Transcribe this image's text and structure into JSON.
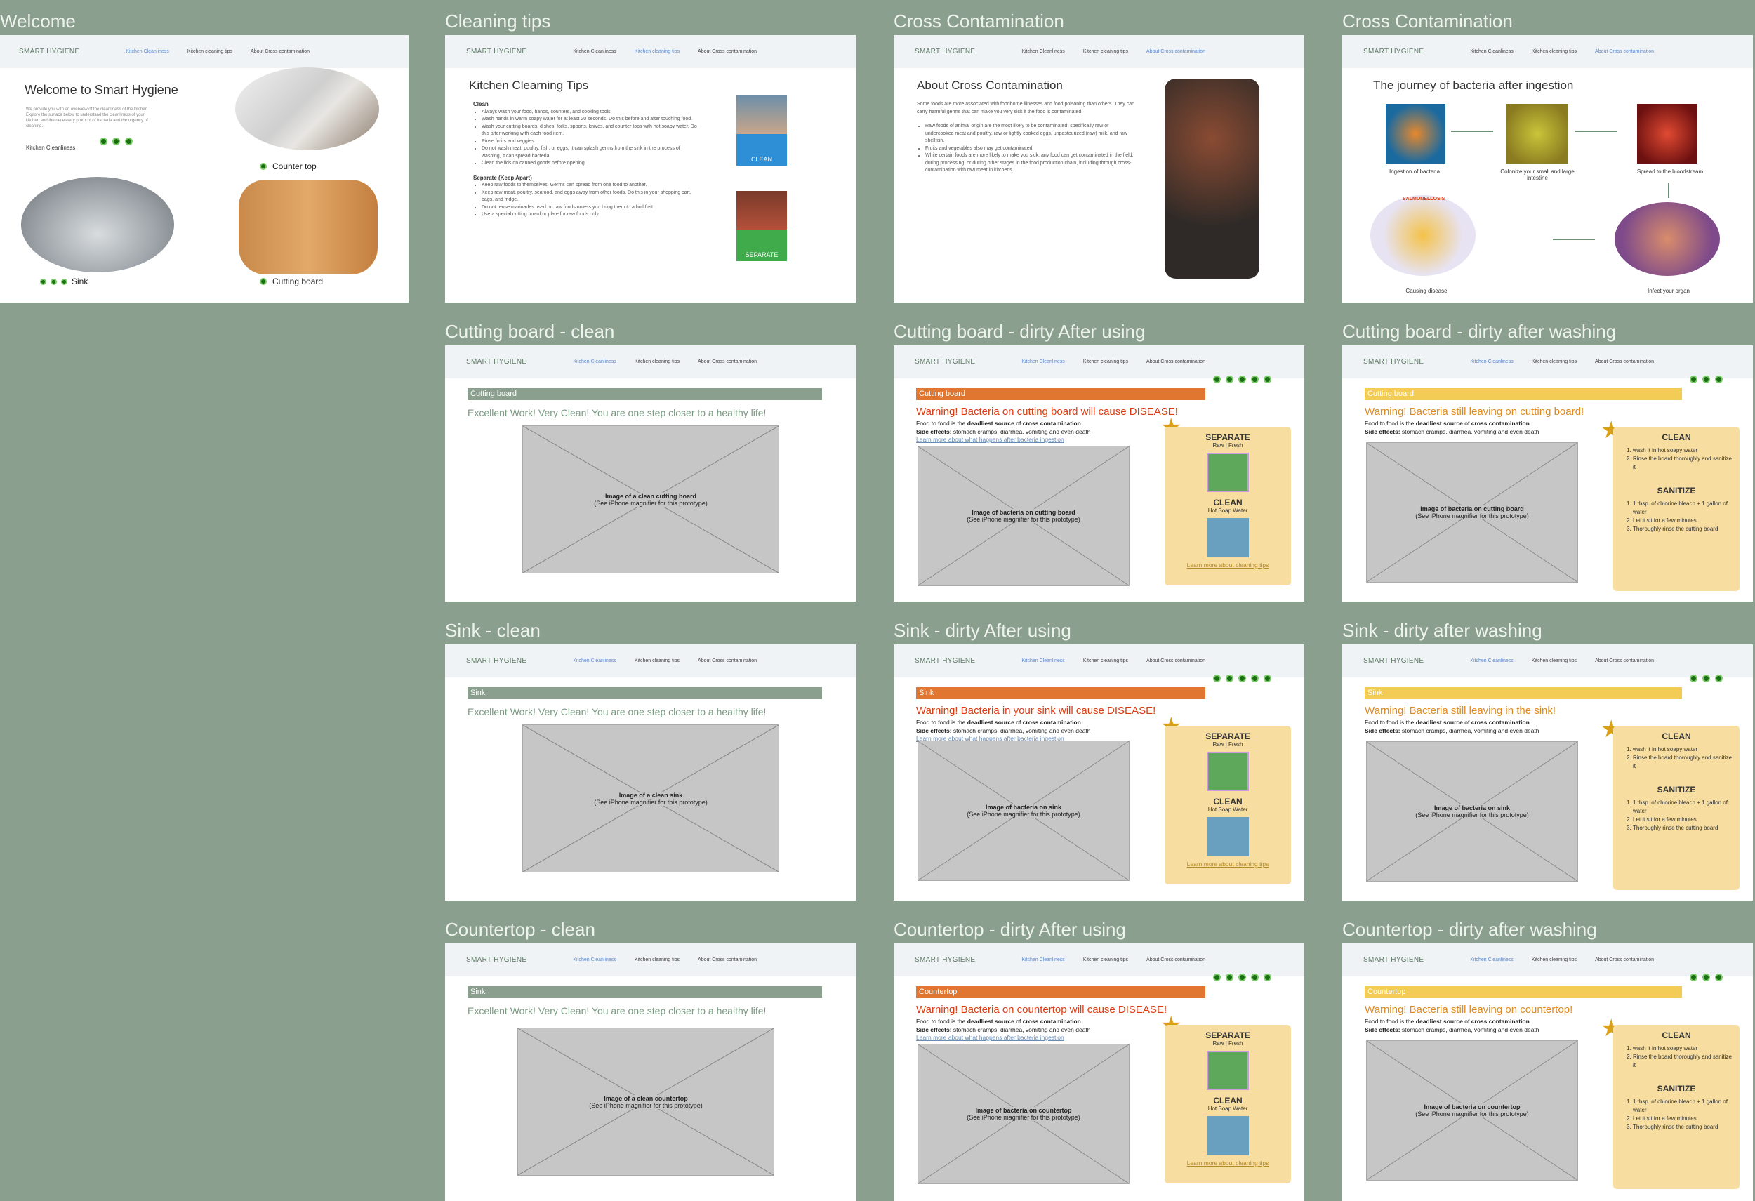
{
  "nav": {
    "logo": "SMART HYGIENE",
    "links": [
      "Kitchen Cleanliness",
      "Kitchen cleaning tips",
      "About Cross contamination"
    ]
  },
  "labels": {
    "welcome": "Welcome",
    "tips": "Cleaning tips",
    "cross1": "Cross Contamination",
    "cross2": "Cross Contamination",
    "cb_clean": "Cutting board - clean",
    "cb_dirty": "Cutting board - dirty After using",
    "cb_wash": "Cutting board - dirty after washing",
    "sink_clean": "Sink - clean",
    "sink_dirty": "Sink - dirty After using",
    "sink_wash": "Sink - dirty after washing",
    "ct_clean": "Countertop - clean",
    "ct_dirty": "Countertop - dirty After using",
    "ct_wash": "Countertop - dirty after washing"
  },
  "welcome": {
    "title": "Welcome to Smart Hygiene",
    "intro": "We provide you with an overview of the cleanliness of the kitchen. Explore the surface below to understand the cleanliness of your kitchen and the necessary protocol of bacteria and the urgency of cleaning.",
    "kitchen_label": "Kitchen Cleanliness",
    "counter": "Counter top",
    "sink": "Sink",
    "board": "Cutting board"
  },
  "tips": {
    "title": "Kitchen Clearning Tips",
    "clean_h": "Clean",
    "clean_items": [
      "Always wash your food, hands, counters, and cooking tools.",
      "Wash hands in warm soapy water for at least 20 seconds. Do this before and after touching food.",
      "Wash your cutting boards, dishes, forks, spoons, knives, and counter tops with hot soapy water. Do this after working with each food item.",
      "Rinse fruits and veggies.",
      "Do not wash meat, poultry, fish, or eggs. It can splash germs from the sink in the process of washing, it can spread bacteria.",
      "Clean the lids on canned goods before opening."
    ],
    "sep_h": "Separate (Keep Apart)",
    "sep_items": [
      "Keep raw foods to themselves. Germs can spread from one food to another.",
      "Keep raw meat, poultry, seafood, and eggs away from other foods. Do this in your shopping cart, bags, and fridge.",
      "Do not reuse marinades used on raw foods unless you bring them to a boil first.",
      "Use a special cutting board or plate for raw foods only."
    ],
    "clean_tag": "CLEAN",
    "sep_tag": "SEPARATE"
  },
  "cross": {
    "title": "About Cross Contamination",
    "p1": "Some foods are more associated with foodborne illnesses and food poisoning than others. They can carry harmful germs that can make you very sick if the food is contaminated.",
    "b1": "Raw foods of animal origin are the most likely to be contaminated, specifically raw or undercooked meat and poultry, raw or lightly cooked eggs, unpasteurized (raw) milk, and raw shellfish.",
    "b2": "Fruits and vegetables also may get contaminated.",
    "b3": "While certain foods are more likely to make you sick, any food can get contaminated in the field, during processing, or during other stages in the food production chain, including through cross-contamination with raw meat in kitchens."
  },
  "journey": {
    "title": "The journey of bacteria after ingestion",
    "s1": "Ingestion of bacteria",
    "s2": "Colonize your small and large intestine",
    "s3": "Spread to the bloodstream",
    "s4": "Infect your organ",
    "s5": "Causing disease",
    "salm": "SALMONELLOSIS"
  },
  "common": {
    "praise": "Excellent Work! Very Clean!  You are one step closer to a healthy life!",
    "food1": "Food to food is the ",
    "food_b": "deadliest source",
    "food2": " of ",
    "food_c": "cross contamination",
    "side_b": "Side effects:",
    "side": " stomach cramps, diarrhea, vomiting and even death",
    "learn": "Learn more about what happens after bacteria ingestion",
    "sep": "SEPARATE",
    "rawfresh": "Raw | Fresh",
    "clean": "CLEAN",
    "hotsoap": "Hot Soap Water",
    "learn2": "Learn more about cleaning tips",
    "sanitize": "SANITIZE",
    "clean_steps": [
      "wash it in hot soapy water",
      "Rinse the board thoroughly and sanitize it"
    ],
    "san_steps": [
      "1 tbsp. of chlorine bleach + 1 gallon of water",
      "Let it sit for a few minutes",
      "Thoroughly rinse the cutting board"
    ],
    "magnifier": "(See iPhone magnifier for this prototype)"
  },
  "screens": {
    "cb_clean": {
      "bar": "Cutting board",
      "img": "Image of a clean cutting board"
    },
    "sink_clean": {
      "bar": "Sink",
      "img": "Image of a clean sink"
    },
    "ct_clean": {
      "bar": "Sink",
      "img": "Image of a clean countertop"
    },
    "cb_dirty": {
      "bar": "Cutting board",
      "warn": "Warning! Bacteria on cutting board will cause DISEASE!",
      "img": "Image of bacteria on cutting board"
    },
    "sink_dirty": {
      "bar": "Sink",
      "warn": "Warning! Bacteria in your sink will cause DISEASE!",
      "img": "Image of bacteria on sink"
    },
    "ct_dirty": {
      "bar": "Countertop",
      "warn": "Warning! Bacteria on countertop will cause DISEASE!",
      "img": "Image of bacteria on countertop"
    },
    "cb_wash": {
      "bar": "Cutting board",
      "warn": "Warning!  Bacteria still leaving on cutting board!",
      "img": "Image of bacteria on cutting board"
    },
    "sink_wash": {
      "bar": "Sink",
      "warn": "Warning!  Bacteria still leaving in the sink!",
      "img": "Image of bacteria on sink"
    },
    "ct_wash": {
      "bar": "Countertop",
      "warn": "Warning!  Bacteria still leaving on countertop!",
      "img": "Image of bacteria on countertop"
    }
  },
  "colors": {
    "bg": "#8a9f8d",
    "green_bar": "#8a9f8d",
    "orange_bar": "#e0762f",
    "yellow_bar": "#f3cc55",
    "warn_red": "#d93c12",
    "warn_orange": "#e08a1e",
    "card": "#f7dea0",
    "dot": "#1a6e12"
  }
}
